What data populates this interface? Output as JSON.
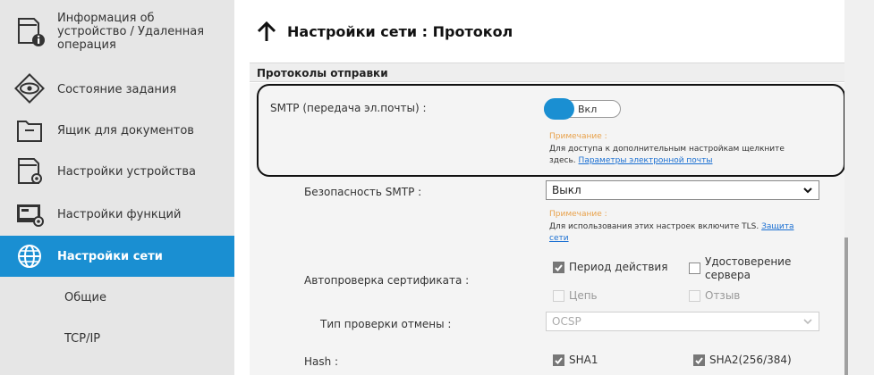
{
  "sidebar": {
    "items": [
      {
        "label_lines": [
          "Информация об",
          "устройство / Удаленная",
          "операция"
        ],
        "icon": "device-info-icon"
      },
      {
        "label": "Состояние задания",
        "icon": "eye-icon"
      },
      {
        "label": "Ящик для документов",
        "icon": "folder-icon"
      },
      {
        "label": "Настройки устройства",
        "icon": "device-settings-icon"
      },
      {
        "label": "Настройки функций",
        "icon": "function-settings-icon"
      },
      {
        "label": "Настройки сети",
        "icon": "globe-icon",
        "active": true
      }
    ],
    "sub_items": [
      {
        "label": "Общие"
      },
      {
        "label": "TCP/IP"
      }
    ],
    "active_color": "#1a8fd2"
  },
  "header": {
    "title": "Настройки сети : Протокол",
    "up_icon": "arrow-up-icon"
  },
  "section": {
    "title": "Протоколы отправки"
  },
  "smtp": {
    "label": "SMTP (передача эл.почты) :",
    "toggle_label": "Вкл",
    "toggle_on": true,
    "note_title": "Примечание :",
    "note_text": "Для доступа к дополнительным настройкам щелкните",
    "note_text2_prefix": "здесь.",
    "note_link": "Параметры электронной почты"
  },
  "smtp_security": {
    "label": "Безопасность SMTP :",
    "value": "Выкл",
    "note_title": "Примечание :",
    "note_text": "Для использования этих настроек включите TLS.",
    "note_link_part1": "Защита",
    "note_link_part2": "сети"
  },
  "cert_check": {
    "label": "Автопроверка сертификата :",
    "options": [
      {
        "label": "Период действия",
        "checked": true,
        "disabled": false
      },
      {
        "label_lines": [
          "Удостоверение",
          "сервера"
        ],
        "checked": false,
        "disabled": false
      },
      {
        "label": "Цепь",
        "checked": false,
        "disabled": true
      },
      {
        "label": "Отзыв",
        "checked": false,
        "disabled": true
      }
    ]
  },
  "revocation": {
    "label": "Тип проверки отмены :",
    "value": "OCSP",
    "disabled": true
  },
  "hash": {
    "label": "Hash :",
    "options": [
      {
        "label": "SHA1",
        "checked": true
      },
      {
        "label": "SHA2(256/384)",
        "checked": true
      }
    ]
  },
  "accent_color": "#1a8fd2",
  "note_color": "#e8a14a"
}
